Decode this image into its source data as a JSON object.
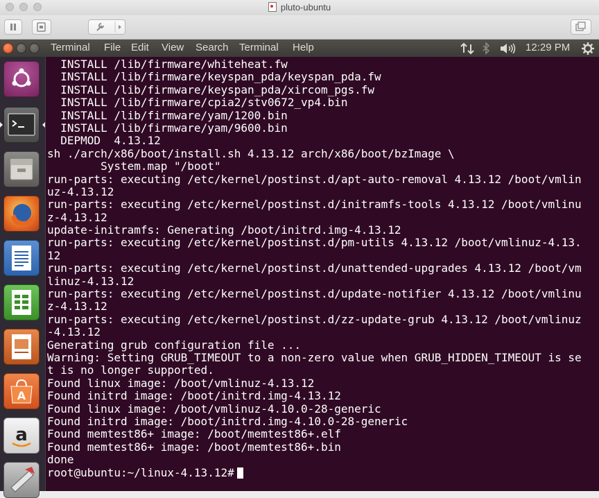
{
  "vm_window": {
    "title": "pluto-ubuntu"
  },
  "top_panel": {
    "menus": [
      "Terminal",
      "File",
      "Edit",
      "View",
      "Search",
      "Terminal",
      "Help"
    ],
    "clock": "12:29 PM"
  },
  "launcher": {
    "items": [
      "ubuntu-dash",
      "terminal",
      "files",
      "firefox",
      "libreoffice-writer",
      "libreoffice-calc",
      "libreoffice-impress",
      "software-center",
      "amazon",
      "system-settings"
    ]
  },
  "terminal": {
    "lines": [
      "  INSTALL /lib/firmware/whiteheat.fw",
      "  INSTALL /lib/firmware/keyspan_pda/keyspan_pda.fw",
      "  INSTALL /lib/firmware/keyspan_pda/xircom_pgs.fw",
      "  INSTALL /lib/firmware/cpia2/stv0672_vp4.bin",
      "  INSTALL /lib/firmware/yam/1200.bin",
      "  INSTALL /lib/firmware/yam/9600.bin",
      "  DEPMOD  4.13.12",
      "sh ./arch/x86/boot/install.sh 4.13.12 arch/x86/boot/bzImage \\",
      "        System.map \"/boot\"",
      "run-parts: executing /etc/kernel/postinst.d/apt-auto-removal 4.13.12 /boot/vmlin",
      "uz-4.13.12",
      "run-parts: executing /etc/kernel/postinst.d/initramfs-tools 4.13.12 /boot/vmlinu",
      "z-4.13.12",
      "update-initramfs: Generating /boot/initrd.img-4.13.12",
      "run-parts: executing /etc/kernel/postinst.d/pm-utils 4.13.12 /boot/vmlinuz-4.13.",
      "12",
      "run-parts: executing /etc/kernel/postinst.d/unattended-upgrades 4.13.12 /boot/vm",
      "linuz-4.13.12",
      "run-parts: executing /etc/kernel/postinst.d/update-notifier 4.13.12 /boot/vmlinu",
      "z-4.13.12",
      "run-parts: executing /etc/kernel/postinst.d/zz-update-grub 4.13.12 /boot/vmlinuz",
      "-4.13.12",
      "Generating grub configuration file ...",
      "Warning: Setting GRUB_TIMEOUT to a non-zero value when GRUB_HIDDEN_TIMEOUT is se",
      "t is no longer supported.",
      "Found linux image: /boot/vmlinuz-4.13.12",
      "Found initrd image: /boot/initrd.img-4.13.12",
      "Found linux image: /boot/vmlinuz-4.10.0-28-generic",
      "Found initrd image: /boot/initrd.img-4.10.0-28-generic",
      "Found memtest86+ image: /boot/memtest86+.elf",
      "Found memtest86+ image: /boot/memtest86+.bin",
      "done"
    ],
    "prompt": "root@ubuntu:~/linux-4.13.12#"
  },
  "colors": {
    "terminal_bg": "#300a24",
    "terminal_fg": "#ffffff",
    "panel_bg": "#3c3b37",
    "launcher_bg": "#2f2a33",
    "close_orange": "#e3551f"
  }
}
